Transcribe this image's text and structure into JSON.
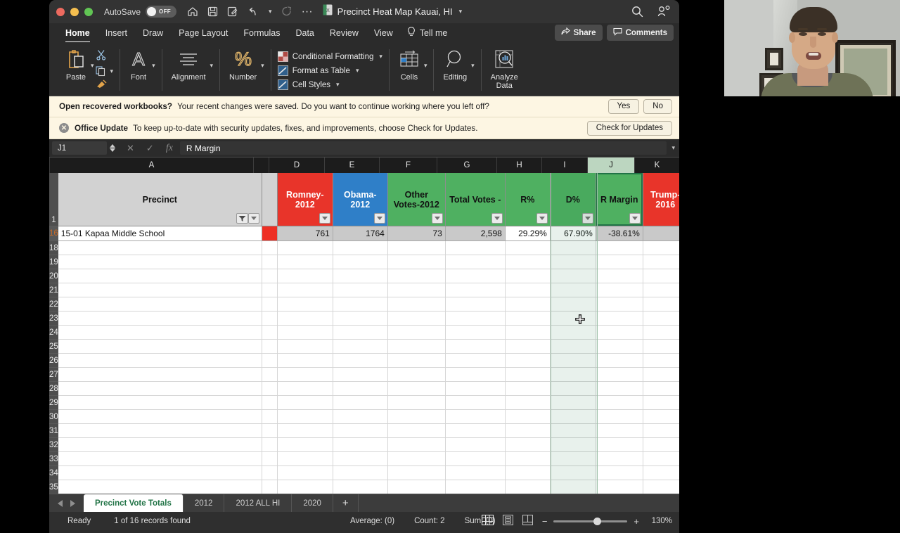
{
  "window": {
    "title": "Precinct Heat Map Kauai, HI",
    "autosave_label": "AutoSave",
    "autosave_state": "OFF"
  },
  "titlebar_icons": [
    "home-icon",
    "save-icon",
    "save-as-icon",
    "undo-icon",
    "undo-dropdown-icon",
    "redo-icon",
    "more-icon"
  ],
  "titlebar_right": [
    "search-icon",
    "account-icon"
  ],
  "ribbon_tabs": [
    {
      "label": "Home",
      "active": true
    },
    {
      "label": "Insert",
      "active": false
    },
    {
      "label": "Draw",
      "active": false
    },
    {
      "label": "Page Layout",
      "active": false
    },
    {
      "label": "Formulas",
      "active": false
    },
    {
      "label": "Data",
      "active": false
    },
    {
      "label": "Review",
      "active": false
    },
    {
      "label": "View",
      "active": false
    }
  ],
  "tell_me": "Tell me",
  "share_label": "Share",
  "comments_label": "Comments",
  "ribbon": {
    "paste": "Paste",
    "font": "Font",
    "alignment": "Alignment",
    "number": "Number",
    "conditional_formatting": "Conditional Formatting",
    "format_as_table": "Format as Table",
    "cell_styles": "Cell Styles",
    "cells": "Cells",
    "editing": "Editing",
    "analyze_data_line1": "Analyze",
    "analyze_data_line2": "Data"
  },
  "notifications": [
    {
      "bold": "Open recovered workbooks?",
      "text": "Your recent changes were saved. Do you want to continue working where you left off?",
      "buttons": [
        "Yes",
        "No"
      ]
    },
    {
      "bold": "Office Update",
      "text": "To keep up-to-date with security updates, fixes, and improvements, choose Check for Updates.",
      "buttons": [
        "Check for Updates"
      ]
    }
  ],
  "formula_bar": {
    "name_box": "J1",
    "value": "R Margin",
    "cancel_icon": "x-icon",
    "confirm_icon": "check-icon",
    "function_icon": "fx-icon"
  },
  "grid": {
    "column_letters": [
      "A",
      "",
      "D",
      "E",
      "F",
      "G",
      "H",
      "I",
      "J",
      "K"
    ],
    "selected_column": "J",
    "header_row_number": "1",
    "data_row_number": "16",
    "empty_row_numbers": [
      "18",
      "19",
      "20",
      "21",
      "22",
      "23",
      "24",
      "25",
      "26",
      "27",
      "28",
      "29",
      "30",
      "31",
      "32",
      "33",
      "34",
      "35"
    ],
    "headers": [
      {
        "text": "Precinct",
        "style": "gray",
        "filter": "active"
      },
      {
        "text": "",
        "style": "narrow",
        "filter": "none"
      },
      {
        "text": "Romney-2012",
        "style": "red",
        "filter": "plain"
      },
      {
        "text": "Obama-2012",
        "style": "blue",
        "filter": "plain"
      },
      {
        "text": "Other Votes-2012",
        "style": "green",
        "filter": "plain"
      },
      {
        "text": "Total Votes -",
        "style": "green",
        "filter": "plain"
      },
      {
        "text": "R%",
        "style": "green",
        "filter": "plain"
      },
      {
        "text": "D%",
        "style": "green",
        "filter": "plain"
      },
      {
        "text": "R Margin",
        "style": "green",
        "filter": "plain"
      },
      {
        "text": "Trump-2016",
        "style": "red",
        "filter": "none"
      }
    ],
    "row": {
      "precinct": "15-01 Kapaa Middle School",
      "marker": "",
      "romney_2012": "761",
      "obama_2012": "1764",
      "other_votes_2012": "73",
      "total_votes": "2,598",
      "r_pct": "29.29%",
      "d_pct": "67.90%",
      "r_margin": "-38.61%",
      "trump_2016": ""
    }
  },
  "sheet_tabs": [
    {
      "label": "Precinct Vote Totals",
      "active": true
    },
    {
      "label": "2012",
      "active": false
    },
    {
      "label": "2012 ALL HI",
      "active": false
    },
    {
      "label": "2020",
      "active": false
    }
  ],
  "add_sheet_label": "+",
  "status_bar": {
    "state": "Ready",
    "records": "1 of 16 records found",
    "average": "Average:  (0)",
    "count": "Count: 2",
    "sum": "Sum:  (0)",
    "zoom": "130%",
    "zoom_out": "−",
    "zoom_in": "+",
    "view_icons": [
      "normal-view-icon",
      "page-layout-icon",
      "page-break-icon"
    ]
  },
  "colors": {
    "republican_red": "#e8342a",
    "democrat_blue": "#2f7fc8",
    "neutral_green": "#4fb061",
    "excel_green": "#217346",
    "notification_bg": "#fdf6e3"
  }
}
